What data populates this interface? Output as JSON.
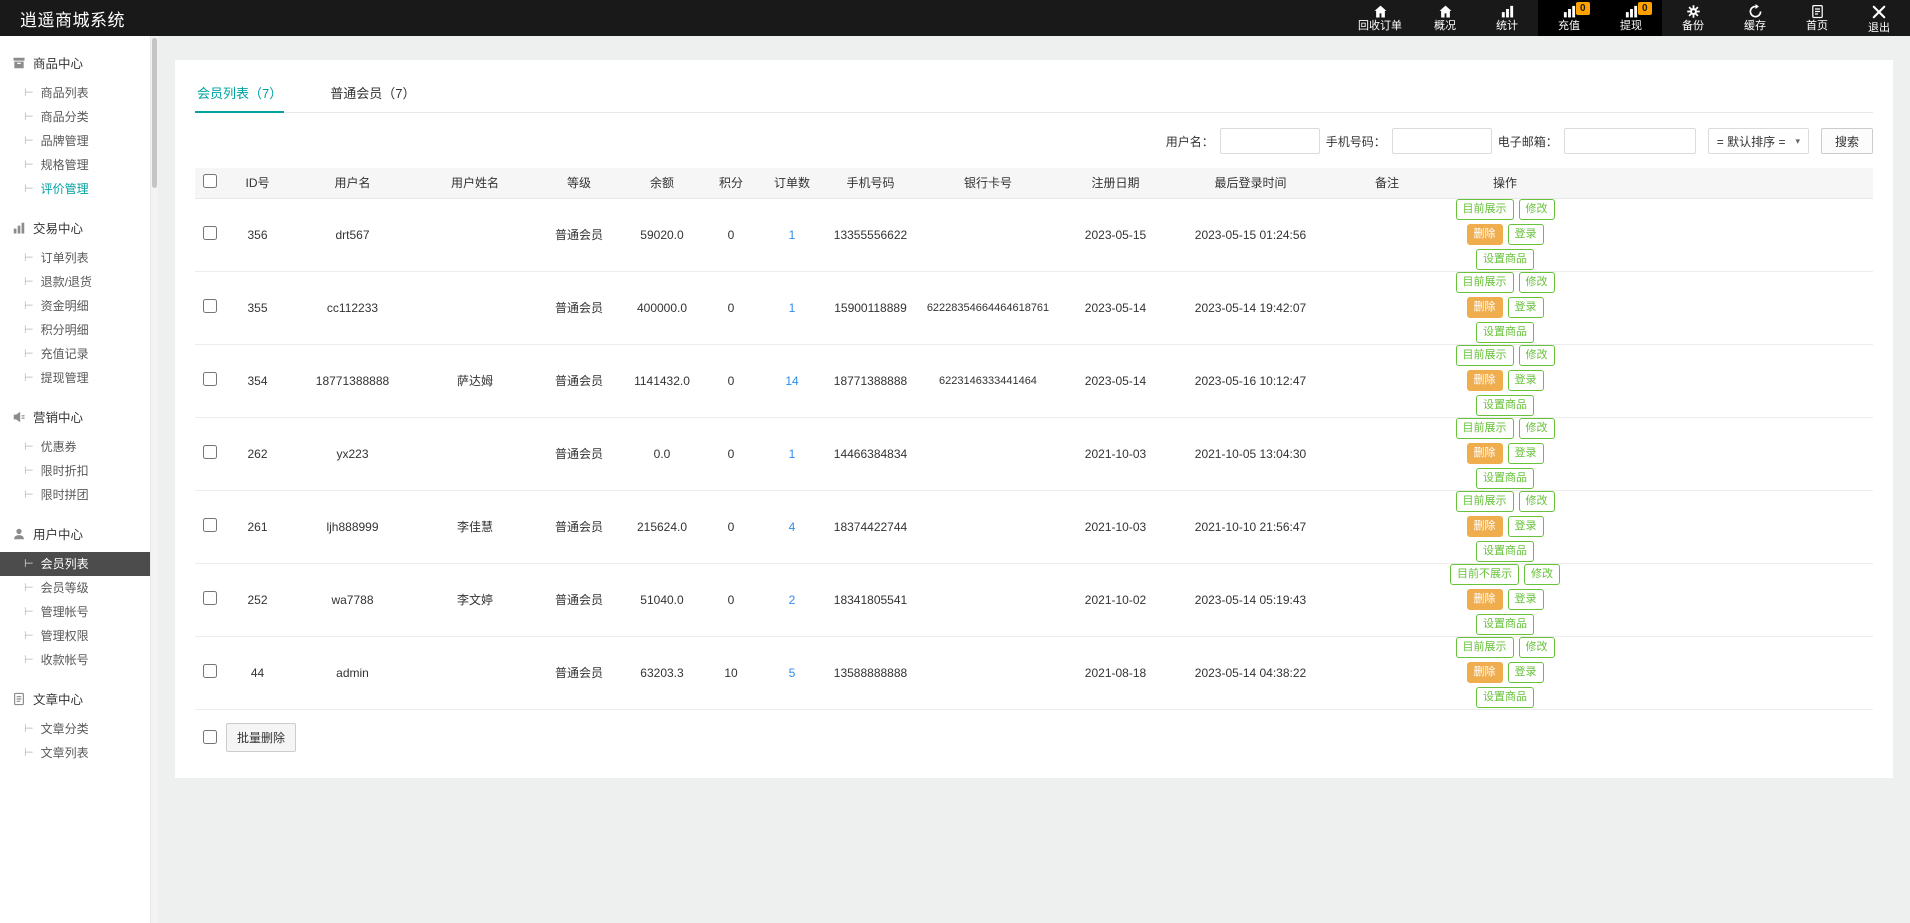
{
  "header": {
    "title": "逍遥商城系统",
    "nav": [
      {
        "label": "回收订单",
        "name": "nav-recycle-orders",
        "icon": "home"
      },
      {
        "label": "概况",
        "name": "nav-overview",
        "icon": "home"
      },
      {
        "label": "统计",
        "name": "nav-statistics",
        "icon": "chart"
      },
      {
        "label": "充值",
        "name": "nav-recharge",
        "icon": "chart",
        "badge": "0",
        "dark": true
      },
      {
        "label": "提现",
        "name": "nav-withdraw",
        "icon": "chart",
        "badge": "0",
        "dark": true
      },
      {
        "label": "备份",
        "name": "nav-backup",
        "icon": "gear"
      },
      {
        "label": "缓存",
        "name": "nav-cache",
        "icon": "refresh"
      },
      {
        "label": "首页",
        "name": "nav-homepage",
        "icon": "page"
      },
      {
        "label": "退出",
        "name": "nav-logout",
        "icon": "exit"
      }
    ]
  },
  "sidebar": {
    "groups": [
      {
        "title": "商品中心",
        "icon": "box",
        "items": [
          {
            "label": "商品列表"
          },
          {
            "label": "商品分类"
          },
          {
            "label": "品牌管理"
          },
          {
            "label": "规格管理"
          },
          {
            "label": "评价管理",
            "teal": true
          }
        ]
      },
      {
        "title": "交易中心",
        "icon": "bars",
        "items": [
          {
            "label": "订单列表"
          },
          {
            "label": "退款/退货"
          },
          {
            "label": "资金明细"
          },
          {
            "label": "积分明细"
          },
          {
            "label": "充值记录"
          },
          {
            "label": "提现管理"
          }
        ]
      },
      {
        "title": "营销中心",
        "icon": "promo",
        "items": [
          {
            "label": "优惠券"
          },
          {
            "label": "限时折扣"
          },
          {
            "label": "限时拼团"
          }
        ]
      },
      {
        "title": "用户中心",
        "icon": "user",
        "items": [
          {
            "label": "会员列表",
            "active": true
          },
          {
            "label": "会员等级"
          },
          {
            "label": "管理帐号"
          },
          {
            "label": "管理权限"
          },
          {
            "label": "收款帐号"
          }
        ]
      },
      {
        "title": "文章中心",
        "icon": "doc",
        "items": [
          {
            "label": "文章分类"
          },
          {
            "label": "文章列表"
          }
        ]
      }
    ]
  },
  "main": {
    "tabs": [
      {
        "label": "会员列表（7）",
        "active": true
      },
      {
        "label": "普通会员（7）",
        "active": false
      }
    ],
    "search": {
      "username_label": "用户名：",
      "phone_label": "手机号码：",
      "email_label": "电子邮箱：",
      "sort_value": "= 默认排序 =",
      "search_button": "搜索"
    },
    "table": {
      "columns": [
        "ID号",
        "用户名",
        "用户姓名",
        "等级",
        "余额",
        "积分",
        "订单数",
        "手机号码",
        "银行卡号",
        "注册日期",
        "最后登录时间",
        "备注",
        "操作"
      ],
      "action_labels": {
        "edit": "修改",
        "delete": "删除",
        "login": "登录",
        "set_product": "设置商品"
      },
      "rows": [
        {
          "id": "356",
          "username": "drt567",
          "name": "",
          "level": "普通会员",
          "balance": "59020.0",
          "points": "0",
          "orders": "1",
          "phone": "13355556622",
          "bank": "",
          "reg_date": "2023-05-15",
          "last_login": "2023-05-15 01:24:56",
          "last_login_red": false,
          "remark": "",
          "show_label": "目前展示"
        },
        {
          "id": "355",
          "username": "cc112233",
          "name": "",
          "level": "普通会员",
          "balance": "400000.0",
          "points": "0",
          "orders": "1",
          "phone": "15900118889",
          "bank": "62228354664464618761",
          "reg_date": "2023-05-14",
          "last_login": "2023-05-14 19:42:07",
          "last_login_red": false,
          "remark": "",
          "show_label": "目前展示"
        },
        {
          "id": "354",
          "username": "18771388888",
          "name": "萨达姆",
          "level": "普通会员",
          "balance": "1141432.0",
          "points": "0",
          "orders": "14",
          "phone": "18771388888",
          "bank": "6223146333441464",
          "reg_date": "2023-05-14",
          "last_login": "2023-05-16 10:12:47",
          "last_login_red": true,
          "remark": "",
          "show_label": "目前展示"
        },
        {
          "id": "262",
          "username": "yx223",
          "name": "",
          "level": "普通会员",
          "balance": "0.0",
          "points": "0",
          "orders": "1",
          "phone": "14466384834",
          "bank": "",
          "reg_date": "2021-10-03",
          "last_login": "2021-10-05 13:04:30",
          "last_login_red": false,
          "remark": "",
          "show_label": "目前展示"
        },
        {
          "id": "261",
          "username": "ljh888999",
          "name": "李佳慧",
          "level": "普通会员",
          "balance": "215624.0",
          "points": "0",
          "orders": "4",
          "phone": "18374422744",
          "bank": "",
          "reg_date": "2021-10-03",
          "last_login": "2021-10-10 21:56:47",
          "last_login_red": false,
          "remark": "",
          "show_label": "目前展示"
        },
        {
          "id": "252",
          "username": "wa7788",
          "name": "李文婷",
          "level": "普通会员",
          "balance": "51040.0",
          "points": "0",
          "orders": "2",
          "phone": "18341805541",
          "bank": "",
          "reg_date": "2021-10-02",
          "last_login": "2023-05-14 05:19:43",
          "last_login_red": false,
          "remark": "",
          "show_label": "目前不展示"
        },
        {
          "id": "44",
          "username": "admin",
          "name": "",
          "level": "普通会员",
          "balance": "63203.3",
          "points": "10",
          "orders": "5",
          "phone": "13588888888",
          "bank": "",
          "reg_date": "2021-08-18",
          "last_login": "2023-05-14 04:38:22",
          "last_login_red": false,
          "remark": "",
          "show_label": "目前展示"
        }
      ]
    },
    "batch_delete_label": "批量删除"
  },
  "colors": {
    "accent": "#00a2a2",
    "balance": "#ff6a00",
    "link": "#2d8cf0",
    "alert": "#e60000",
    "badge": "#ffa200",
    "btn_green": "#67c23a",
    "btn_warn": "#f0ad4e"
  }
}
